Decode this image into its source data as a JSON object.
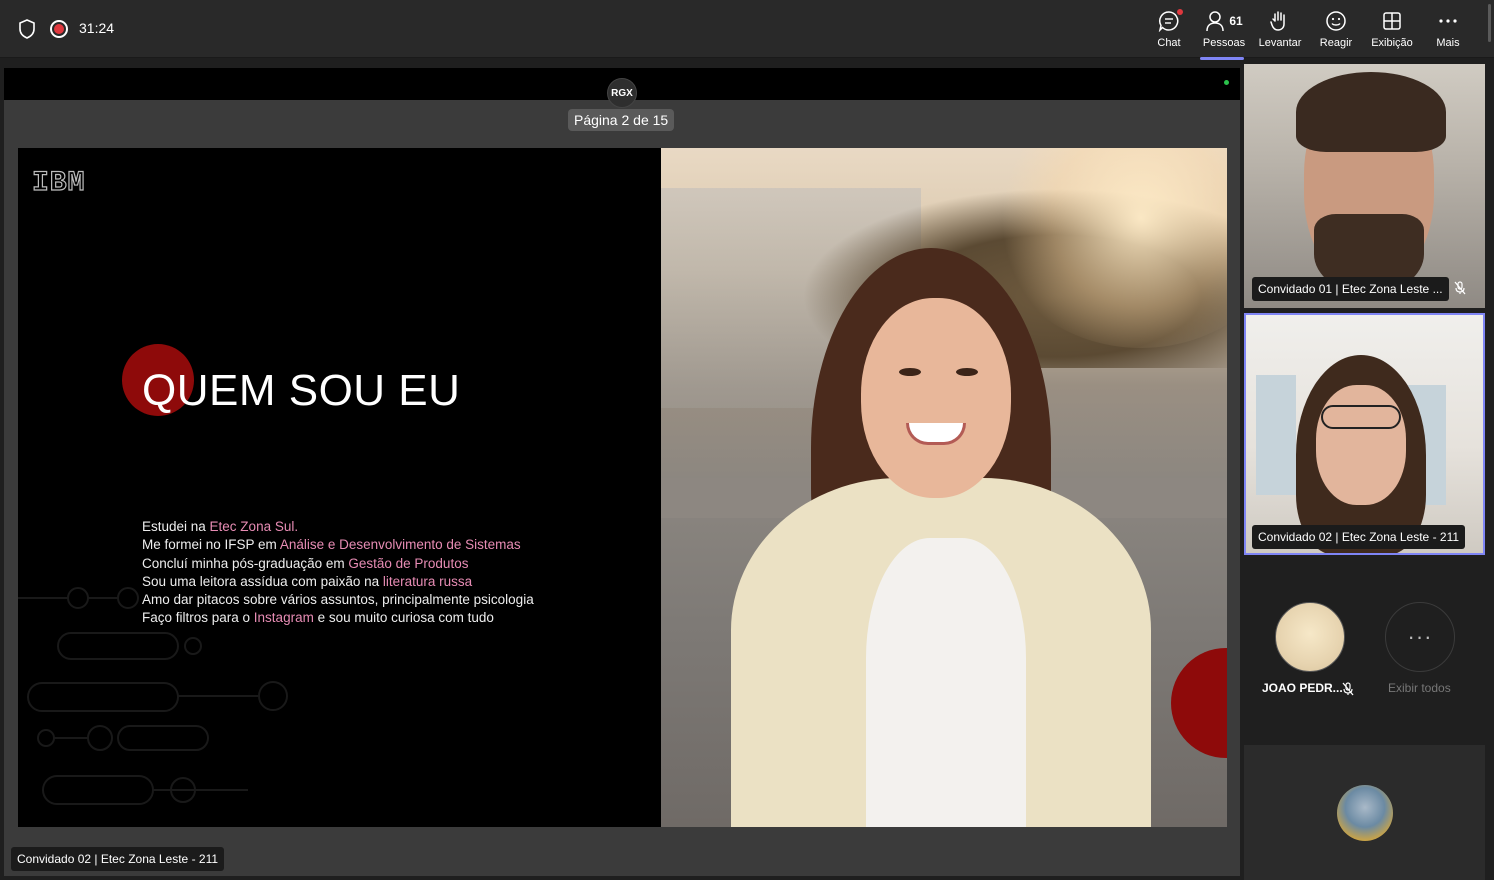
{
  "topbar": {
    "timer": "31:24",
    "buttons": {
      "chat": "Chat",
      "people": "Pessoas",
      "people_count": "61",
      "raise": "Levantar",
      "react": "Reagir",
      "view": "Exibição",
      "more": "Mais"
    }
  },
  "stage": {
    "presenter_badge": "RGX",
    "page_indicator": "Página 2 de 15",
    "presenter_label": "Convidado 02 | Etec Zona Leste - 211",
    "slide": {
      "logo": "IBM",
      "title": "QUEM SOU EU",
      "bio": [
        {
          "text": "Estudei na ",
          "hl": "Etec Zona Sul.",
          "after": ""
        },
        {
          "text": "Me formei no IFSP em ",
          "hl": "Análise e Desenvolvimento de Sistemas",
          "after": ""
        },
        {
          "text": "Concluí minha pós-graduação em ",
          "hl": "Gestão de Produtos",
          "after": ""
        },
        {
          "text": "Sou uma leitora assídua com paixão na ",
          "hl": "literatura russa",
          "after": ""
        },
        {
          "text": "Amo dar pitacos sobre vários assuntos, principalmente psicologia",
          "hl": "",
          "after": ""
        },
        {
          "text": "Faço filtros para o ",
          "hl": "Instagram",
          "after": " e sou muito curiosa com tudo"
        }
      ]
    }
  },
  "participants": {
    "tile1_name": "Convidado 01 | Etec Zona Leste ...",
    "tile2_name": "Convidado 02 | Etec Zona Leste - 211",
    "joao_name": "JOAO PEDR...",
    "show_all": "Exibir todos",
    "more_glyph": "···"
  },
  "colors": {
    "accent": "#7f85f5",
    "recording": "#e0383e",
    "slide_highlight": "#e78cb4",
    "slide_red": "#8e0a0a"
  }
}
